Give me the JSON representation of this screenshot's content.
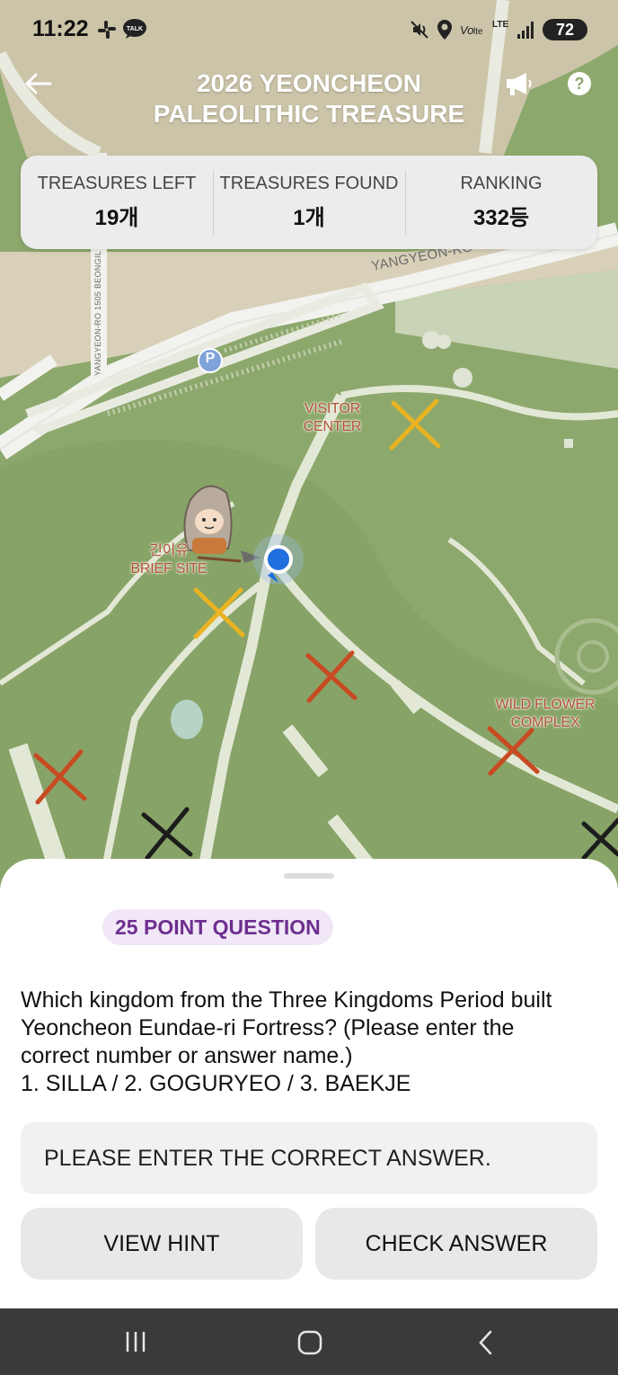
{
  "status_bar": {
    "time": "11:22",
    "network": "LTE",
    "battery": "72",
    "icons": [
      "slack-icon",
      "talk-icon",
      "mute-icon",
      "location-icon",
      "volte-icon",
      "lte-icon",
      "signal-icon",
      "battery-icon"
    ]
  },
  "header": {
    "title_line1": "2026 YEONCHEON",
    "title_line2": "PALEOLITHIC TREASURE",
    "icons": [
      "back-arrow-icon",
      "megaphone-icon",
      "help-icon"
    ],
    "help_glyph": "?"
  },
  "stats": [
    {
      "label": "TREASURES LEFT",
      "value": "19개"
    },
    {
      "label": "TREASURES FOUND",
      "value": "1개"
    },
    {
      "label": "RANKING",
      "value": "332등"
    }
  ],
  "map": {
    "roads": {
      "main": "YANGYEON-RO",
      "side": "YANGYEON-RO 1505 BEONGIL"
    },
    "parking_glyph": "P",
    "places": {
      "visitor_line1": "VISITOR",
      "visitor_line2": "CENTER",
      "brief_line1": "긴이유",
      "brief_line2": "BRIEF SITE",
      "wild_line1": "WILD FLOWER",
      "wild_line2": "COMPLEX"
    },
    "colors": {
      "grass": "#8da86d",
      "path": "#e9ebe0",
      "marker_yellow": "#e9b322",
      "marker_red": "#c84a22",
      "marker_black": "#1c1c1c",
      "user_location": "#1f6fde"
    }
  },
  "question_sheet": {
    "badge": "25 POINT QUESTION",
    "question_lines": [
      "Which kingdom from the Three Kingdoms Period built",
      "Yeoncheon Eundae-ri Fortress? (Please enter the",
      "correct number or answer name.)",
      "1. SILLA / 2. GOGURYEO / 3. BAEKJE"
    ],
    "input_placeholder": "PLEASE ENTER THE CORRECT ANSWER.",
    "hint_button": "VIEW HINT",
    "check_button": "CHECK ANSWER",
    "accent": "#6d2f8f"
  },
  "nav_bar": {
    "icons": [
      "recents-icon",
      "home-icon",
      "back-icon"
    ]
  }
}
